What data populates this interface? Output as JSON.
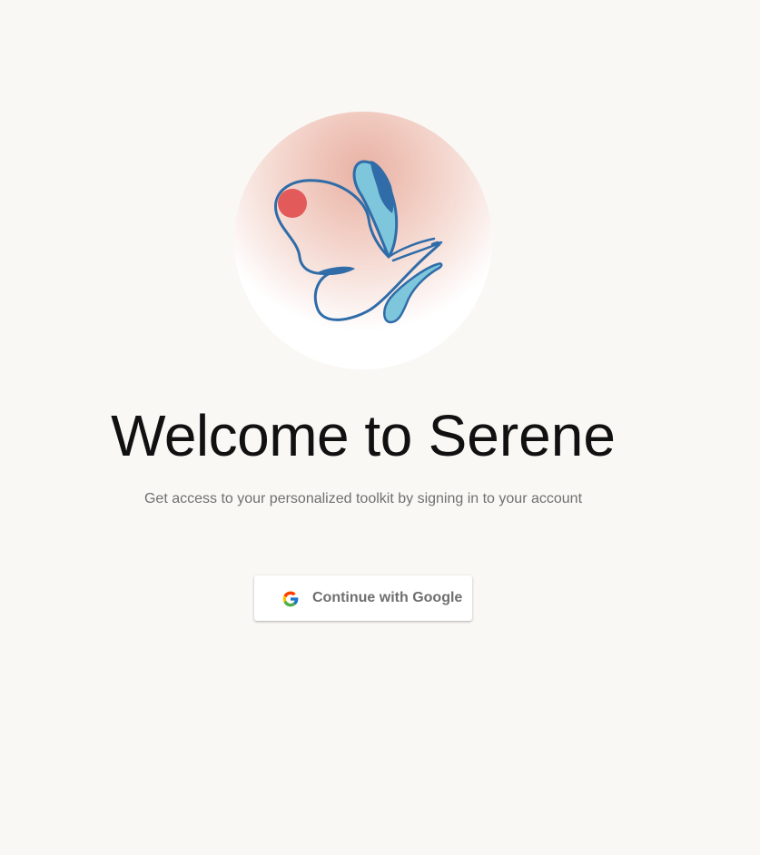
{
  "welcome": {
    "title_prefix": "Welcome to",
    "title_brand": "Serene",
    "subtitle": "Get access to your personalized toolkit by signing in to your account"
  },
  "auth": {
    "google_button_label": "Continue with Google"
  },
  "icons": {
    "logo": "butterfly-logo-icon",
    "google": "google-g-icon"
  },
  "colors": {
    "background": "#f9f8f5",
    "logo_blue": "#2f6ca8",
    "logo_light_blue": "#7ec6dc",
    "logo_red_dot": "#e35a5a",
    "logo_glow": "#e9b1a4"
  }
}
